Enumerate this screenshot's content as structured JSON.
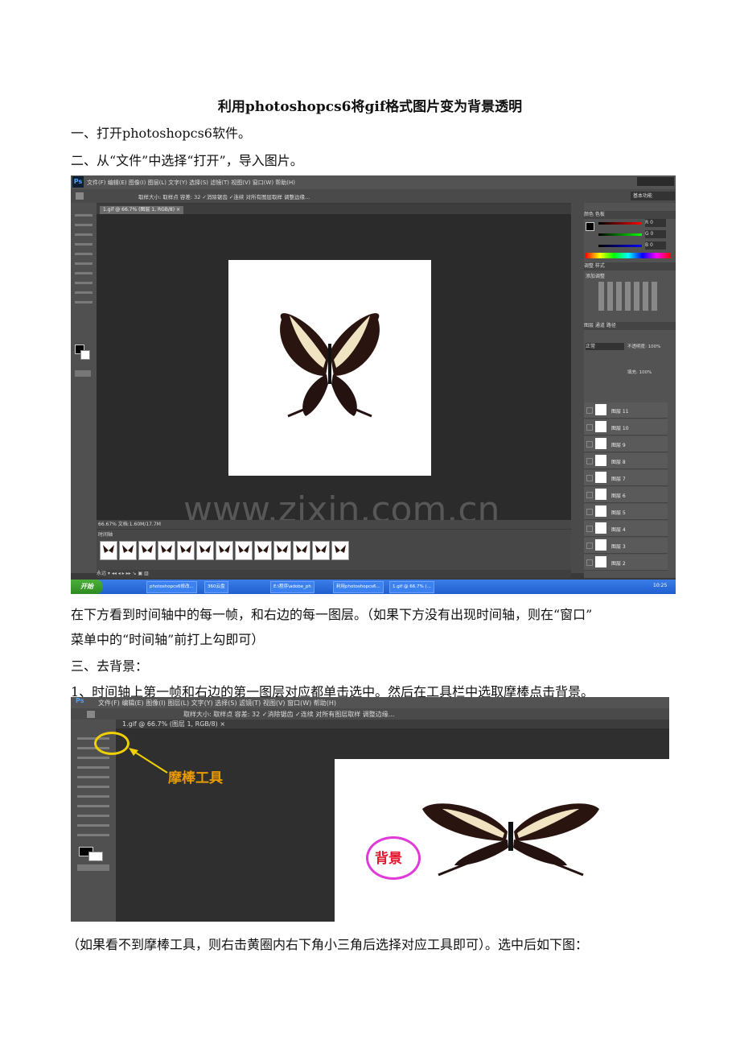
{
  "doc": {
    "title": "利用photoshopcs6将gif格式图片变为背景透明",
    "step1": "一、打开photoshopcs6软件。",
    "step2": "二、从“文件”中选择“打开”，导入图片。",
    "caption1a": "在下方看到时间轴中的每一帧，和右边的每一图层。（如果下方没有出现时间轴，则在“窗口”",
    "caption1b": "菜单中的“时间轴”前打上勾即可）",
    "step3": "三、去背景：",
    "step3_1": "1、时间轴上第一帧和右边的第一图层对应都单击选中。然后在工具栏中选取摩棒点击背景。",
    "caption2": "（如果看不到摩棒工具，则右击黄圈内右下角小三角后选择对应工具即可）。选中后如下图："
  },
  "shot1": {
    "ps_logo": "Ps",
    "menu": "文件(F)  编辑(E)  图像(I)  图层(L)  文字(Y)  选择(S)  滤镜(T)  视图(V)  窗口(W)  帮助(H)",
    "options": "取样大小: 取样点   容差: 32   ✓消除锯齿  ✓连续   对所有图层取样   调整边缘...",
    "workspace": "基本功能",
    "tab": "1.gif @ 66.7% (图层 1, RGB/8) ×",
    "watermark": "www.zixin.com.cn",
    "status": "66.67%     文档:1.60M/17.7M",
    "timeline_label": "时间轴",
    "timeline_controls": "永远  ▾   ◂◂  ◂  ▸  ▸▸   ↘  ▣  ▥",
    "panel_color": "颜色   色板",
    "panel_adjust": "调整   样式",
    "adjust_add": "添加调整",
    "panel_layers": "图层   通道   路径",
    "blend_mode": "正常",
    "opacity_label": "不透明度: 100%",
    "fill_label": "填充: 100%",
    "rgb_values": [
      "R 0",
      "G 0",
      "B 0"
    ],
    "layers": [
      "图层 11",
      "图层 10",
      "图层 9",
      "图层 8",
      "图层 7",
      "图层 6",
      "图层 5",
      "图层 4",
      "图层 3",
      "图层 2"
    ],
    "taskbar": {
      "start": "开始",
      "tasks": [
        "photoshopcs6修改...",
        "360云盘",
        "E:\\程序\\adobe_ph",
        "利用photoshopcs6...",
        "1.gif @ 66.7% (..."
      ],
      "clock": "10:25"
    }
  },
  "shot2": {
    "menu": "文件(F)   编辑(E)   图像(I)   图层(L)   文字(Y)   选择(S)   滤镜(T)   视图(V)   窗口(W)   帮助(H)",
    "options": "取样大小:  取样点        容差: 32     ✓消除锯齿   ✓连续    对所有图层取样     调整边缘...",
    "tab": "1.gif @ 66.7% (图层 1, RGB/8) ×",
    "label_tool": "摩棒工具",
    "label_bg": "背景"
  },
  "colors": {
    "yellow_circle": "#f0d000",
    "label_tool": "#e89a00",
    "pink_circle": "#e03ad8",
    "label_bg": "#e0162c"
  }
}
